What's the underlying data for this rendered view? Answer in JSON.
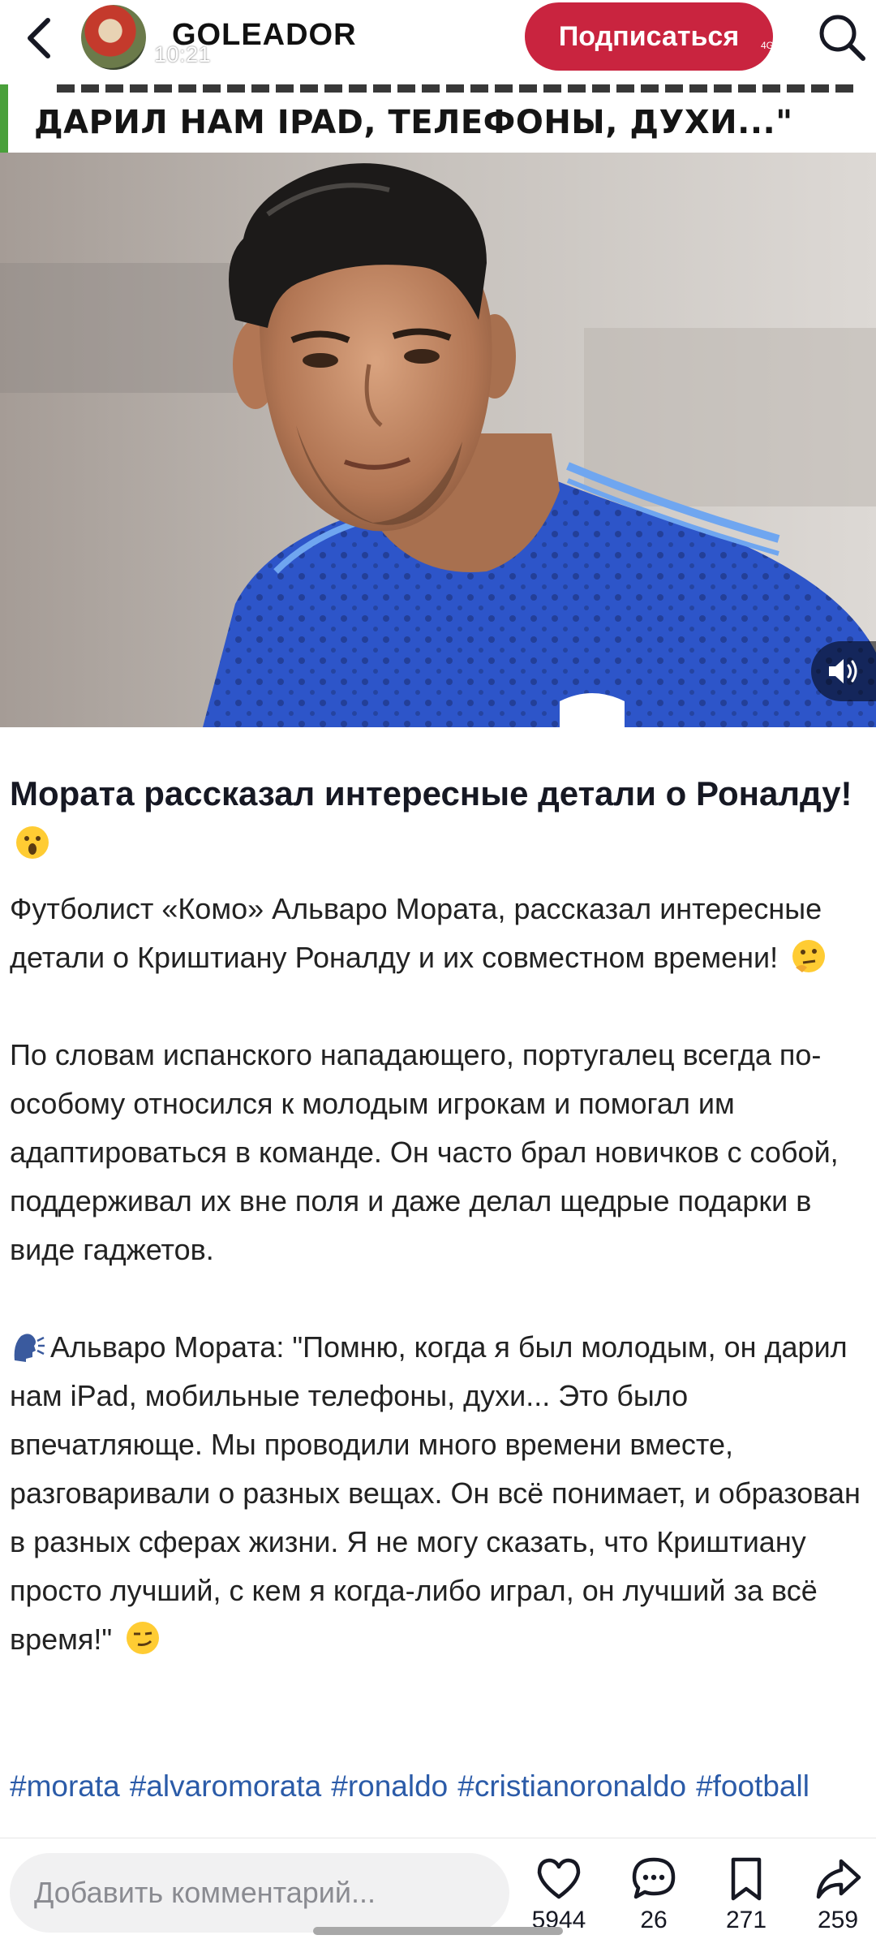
{
  "status_bar": {
    "time": "10:21",
    "network": "4G"
  },
  "header": {
    "account_name": "GOLEADOR",
    "follow_label": "Подписаться"
  },
  "banner": {
    "text": "ДАРИЛ НАМ IPAD, ТЕЛЕФОНЫ, ДУХИ...\""
  },
  "post": {
    "title": "Мората рассказал интересные детали о Роналду!",
    "paragraphs": [
      "Футболист «Комо» Альваро Мората, рассказал интересные детали о Криштиану Роналду и их совместном времени!",
      "По словам испанского нападающего, португалец всегда по-особому относился к молодым игрокам и помогал им адаптироваться в команде. Он часто брал новичков с собой, поддерживал их вне поля и даже делал щедрые подарки в виде гаджетов.",
      "Альваро Мората: \"Помню, когда я был молодым, он дарил нам iPad, мобильные телефоны, духи... Это было впечатляюще. Мы проводили много времени вместе, разговаривали о разных вещах. Он всё понимает, и образован в разных сферах жизни. Я не могу сказать, что Криштиану просто лучший, с кем я когда-либо играл, он лучший за всё время!\""
    ],
    "hashtags": [
      "#morata",
      "#alvaromorata",
      "#ronaldo",
      "#cristianoronaldo",
      "#football"
    ]
  },
  "bottom_bar": {
    "comment_placeholder": "Добавить комментарий...",
    "likes": "5944",
    "comments": "26",
    "saves": "271",
    "shares": "259"
  },
  "colors": {
    "follow_button": "#c9243f",
    "hashtag": "#2b5ba8",
    "jersey_blue": "#2d55c9",
    "banner_accent": "#49a03a"
  },
  "icons": [
    "back-arrow-icon",
    "search-icon",
    "sound-icon",
    "heart-icon",
    "comment-icon",
    "bookmark-icon",
    "share-icon"
  ]
}
